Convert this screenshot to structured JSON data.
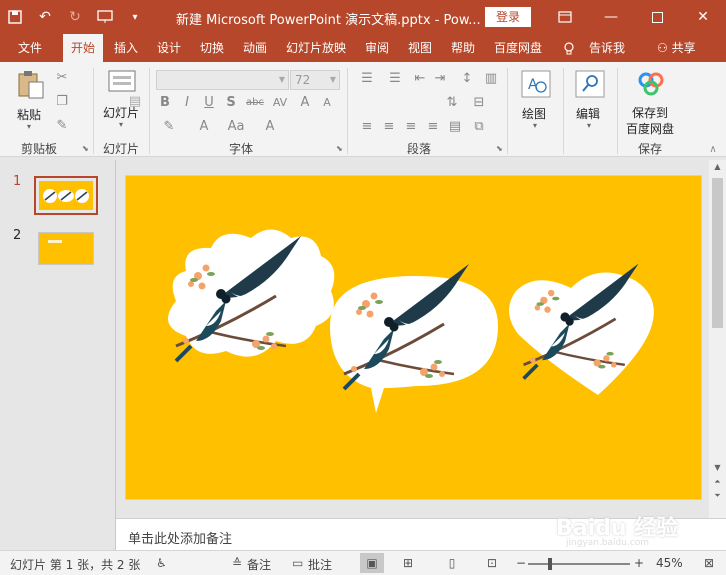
{
  "colors": {
    "accent": "#b7472a",
    "slide_bg": "#ffc000",
    "ribbon_bg": "#f3f3f3"
  },
  "titlebar": {
    "title": "新建 Microsoft PowerPoint 演示文稿.pptx  -  Pow...",
    "login_label": "登录",
    "qat_icons": [
      "save-icon",
      "undo-icon",
      "redo-icon",
      "present-from-start-icon",
      "customize-qat-icon"
    ]
  },
  "tabs": [
    "文件",
    "开始",
    "插入",
    "设计",
    "切换",
    "动画",
    "幻灯片放映",
    "审阅",
    "视图",
    "帮助",
    "百度网盘"
  ],
  "active_tab": "开始",
  "tell_me": "告诉我",
  "share": "共享",
  "ribbon": {
    "clipboard": {
      "paste_label": "粘贴",
      "group_label": "剪贴板"
    },
    "slides": {
      "new_slide_label": "幻灯片",
      "group_label": "幻灯片"
    },
    "font": {
      "font_name": "",
      "font_size": "72",
      "group_label": "字体"
    },
    "paragraph": {
      "group_label": "段落"
    },
    "drawing": {
      "label": "绘图"
    },
    "editing": {
      "label": "编辑"
    },
    "save": {
      "label_line1": "保存到",
      "label_line2": "百度网盘",
      "group_label": "保存"
    }
  },
  "slides_pane": {
    "items": [
      {
        "number": "1",
        "selected": true
      },
      {
        "number": "2",
        "selected": false
      }
    ]
  },
  "notes": {
    "placeholder": "单击此处添加备注"
  },
  "statusbar": {
    "slide_info": "幻灯片 第 1 张，共 2 张",
    "notes_label": "备注",
    "comments_label": "批注",
    "zoom_minus": "−",
    "zoom_plus": "+",
    "zoom": "45%"
  },
  "watermark": {
    "text": "Bai du 经验",
    "sub": "jingyan.baidu.com"
  }
}
